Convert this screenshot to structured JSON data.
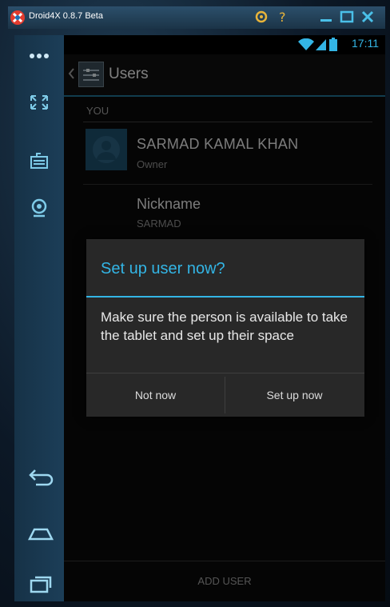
{
  "window": {
    "title": "Droid4X 0.8.7 Beta"
  },
  "status_bar": {
    "time": "17:11"
  },
  "action_bar": {
    "title": "Users"
  },
  "users": {
    "section_header": "YOU",
    "current_user": {
      "name": "SARMAD KAMAL KHAN",
      "role": "Owner"
    },
    "nickname": {
      "label": "Nickname",
      "value": "SARMAD"
    }
  },
  "dialog": {
    "title": "Set up user now?",
    "message": "Make sure the person is available to take the tablet and set up their space",
    "negative_button": "Not now",
    "positive_button": "Set up now"
  },
  "footer": {
    "add_user": "ADD USER"
  },
  "colors": {
    "accent": "#33b5e5",
    "dialog_background": "#282828",
    "sidebar": "#1c3e58"
  },
  "icons": {
    "sidebar": [
      "menu-dots-icon",
      "fullscreen-icon",
      "keyboard-icon",
      "camera-icon",
      "back-icon",
      "home-icon",
      "recent-apps-icon"
    ],
    "titlebar": [
      "settings-icon",
      "help-icon",
      "minimize-icon",
      "maximize-icon",
      "close-icon"
    ],
    "status": [
      "wifi-icon",
      "signal-icon",
      "battery-icon"
    ]
  }
}
